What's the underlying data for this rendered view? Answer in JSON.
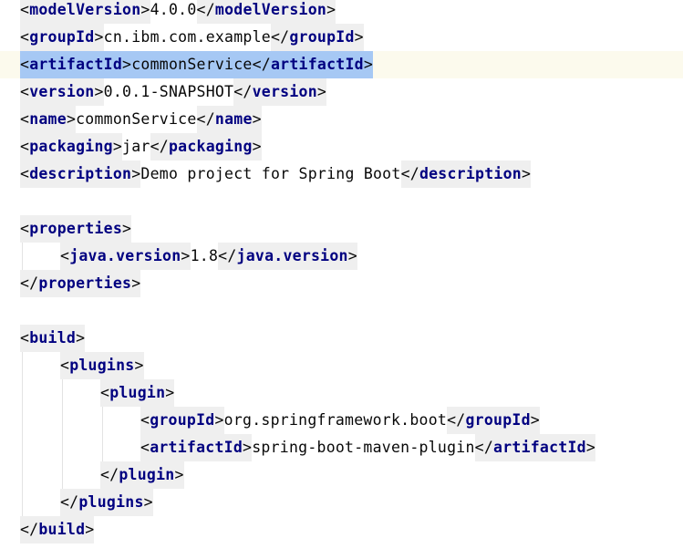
{
  "editor": {
    "lines": [
      {
        "indent": 0,
        "tag": "modelVersion",
        "value": "4.0.0"
      },
      {
        "indent": 0,
        "tag": "groupId",
        "value": "cn.ibm.com.example"
      },
      {
        "indent": 0,
        "tag": "artifactId",
        "value": "commonService",
        "selected": true
      },
      {
        "indent": 0,
        "tag": "version",
        "value": "0.0.1-SNAPSHOT"
      },
      {
        "indent": 0,
        "tag": "name",
        "value": "commonService"
      },
      {
        "indent": 0,
        "tag": "packaging",
        "value": "jar"
      },
      {
        "indent": 0,
        "tag": "description",
        "value": "Demo project for Spring Boot"
      },
      {
        "blank": true
      },
      {
        "indent": 0,
        "open": "properties"
      },
      {
        "indent": 1,
        "tag": "java.version",
        "value": "1.8"
      },
      {
        "indent": 0,
        "close": "properties"
      },
      {
        "blank": true
      },
      {
        "indent": 0,
        "open": "build"
      },
      {
        "indent": 1,
        "open": "plugins"
      },
      {
        "indent": 2,
        "open": "plugin"
      },
      {
        "indent": 3,
        "tag": "groupId",
        "value": "org.springframework.boot"
      },
      {
        "indent": 3,
        "tag": "artifactId",
        "value": "spring-boot-maven-plugin"
      },
      {
        "indent": 2,
        "close": "plugin"
      },
      {
        "indent": 1,
        "close": "plugins"
      },
      {
        "indent": 0,
        "close": "build"
      }
    ]
  }
}
